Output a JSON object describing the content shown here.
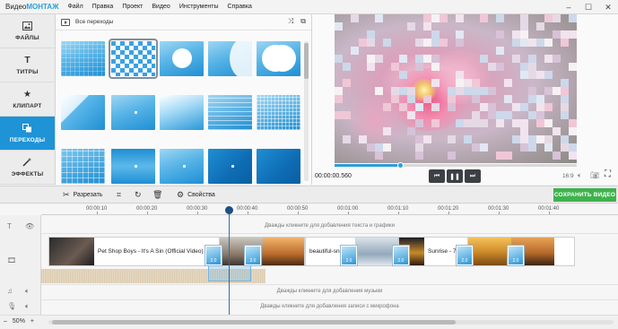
{
  "app": {
    "logo_prefix": "Видео",
    "logo_brand": "МОНТАЖ"
  },
  "menu": [
    "Файл",
    "Правка",
    "Проект",
    "Видео",
    "Инструменты",
    "Справка"
  ],
  "window_controls": [
    "–",
    "☐",
    "✕"
  ],
  "sidebar": [
    {
      "label": "ФАЙЛЫ",
      "icon": "image-icon",
      "active": false
    },
    {
      "label": "ТИТРЫ",
      "icon": "text-icon",
      "active": false
    },
    {
      "label": "КЛИПАРТ",
      "icon": "star-icon",
      "active": false
    },
    {
      "label": "ПЕРЕХОДЫ",
      "icon": "transitions-icon",
      "active": true
    },
    {
      "label": "ЭФФЕКТЫ",
      "icon": "magic-wand-icon",
      "active": false
    }
  ],
  "transitions_panel": {
    "title": "Все переходы",
    "tools": [
      "shuffle-icon",
      "split-screen-icon"
    ]
  },
  "preview": {
    "timecode": "00:00:00.560",
    "aspect": "16:9",
    "progress": 0.27
  },
  "toolbar": {
    "cut_label": "Разрезать",
    "properties_label": "Свойства",
    "save_label": "СОХРАНИТЬ ВИДЕО",
    "save_color": "#3fb24c"
  },
  "timeline": {
    "ticks": [
      "00:00:10",
      "00:00:20",
      "00:00:30",
      "00:00:40",
      "00:00:50",
      "00:01:00",
      "00:01:10",
      "00:01:20",
      "00:01:30",
      "00:01:40"
    ],
    "text_hint": "Дважды кликните для добавления текста и графики",
    "clips": [
      {
        "label": "Pet Shop Boys - It's A Sin (Official Video)"
      },
      {
        "label": "beautiful-snow"
      },
      {
        "label": "Sunrise - 7127.mp4"
      }
    ],
    "transition_durations": [
      "2.0",
      "2.0",
      "2.0",
      "2.0",
      "2.0",
      "2.0"
    ],
    "music_hint": "Дважды кликните для добавления музыки",
    "mic_hint": "Дважды кликните для добавления записи с микрофона",
    "zoom": "50%",
    "zoom_minus": "–",
    "zoom_plus": "+"
  },
  "accent_color": "#1e93d6"
}
